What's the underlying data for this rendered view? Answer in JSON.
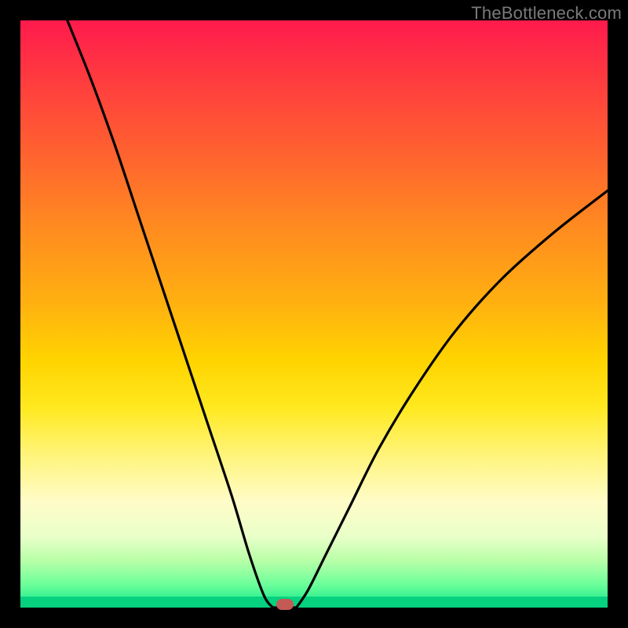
{
  "watermark": "TheBottleneck.com",
  "colors": {
    "frame": "#000000",
    "curve": "#000000",
    "marker": "#c35a55",
    "baseline": "#06d17f"
  },
  "chart_data": {
    "type": "line",
    "title": "",
    "xlabel": "",
    "ylabel": "",
    "xlim": [
      0,
      100
    ],
    "ylim": [
      0,
      100
    ],
    "grid": false,
    "legend": false,
    "series": [
      {
        "name": "left-branch",
        "x": [
          8,
          12,
          16,
          20,
          24,
          28,
          32,
          36,
          39,
          41.5,
          43
        ],
        "y": [
          100,
          90,
          79,
          67,
          55,
          43,
          31,
          19,
          9,
          2,
          0
        ]
      },
      {
        "name": "right-branch",
        "x": [
          47,
          49,
          52,
          56,
          61,
          67,
          74,
          82,
          91,
          100
        ],
        "y": [
          0,
          3,
          9,
          17,
          27,
          37,
          47,
          56,
          64,
          71
        ]
      },
      {
        "name": "flat-minimum",
        "x": [
          43,
          45,
          47
        ],
        "y": [
          0,
          0,
          0
        ]
      }
    ],
    "annotations": [
      {
        "name": "minimum-marker",
        "x": 45,
        "y": 0
      }
    ]
  }
}
